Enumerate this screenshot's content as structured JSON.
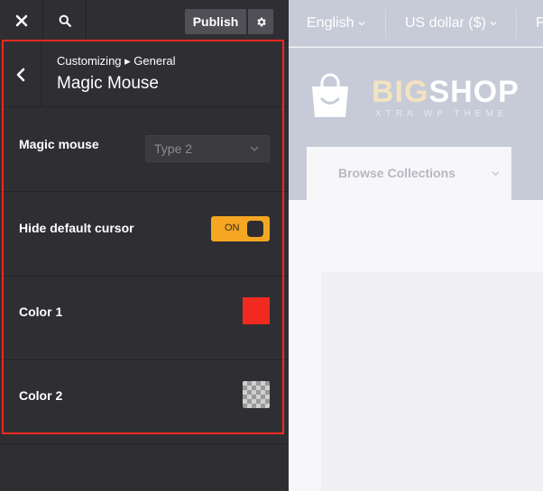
{
  "topbar": {
    "close_icon": "close-icon",
    "search_icon": "search-icon",
    "publish_label": "Publish",
    "settings_icon": "gear-icon"
  },
  "section": {
    "breadcrumb": "Customizing ▸ General",
    "title": "Magic Mouse",
    "back_icon": "chevron-left-icon"
  },
  "settings": {
    "magic_mouse": {
      "label": "Magic mouse",
      "value": "Type 2"
    },
    "hide_cursor": {
      "label": "Hide default cursor",
      "toggle_text": "ON",
      "enabled": true
    },
    "color1": {
      "label": "Color 1",
      "value": "#f2291f"
    },
    "color2": {
      "label": "Color 2",
      "value": "transparent"
    }
  },
  "preview": {
    "language": "English",
    "currency": "US dollar ($)",
    "cut_link": "F",
    "logo_big": "BIG",
    "logo_shop": "SHOP",
    "logo_sub": "XTRA WP THEME",
    "browse_label": "Browse Collections"
  },
  "colors": {
    "highlight": "#f2291f",
    "toggle_on": "#f5a623"
  }
}
